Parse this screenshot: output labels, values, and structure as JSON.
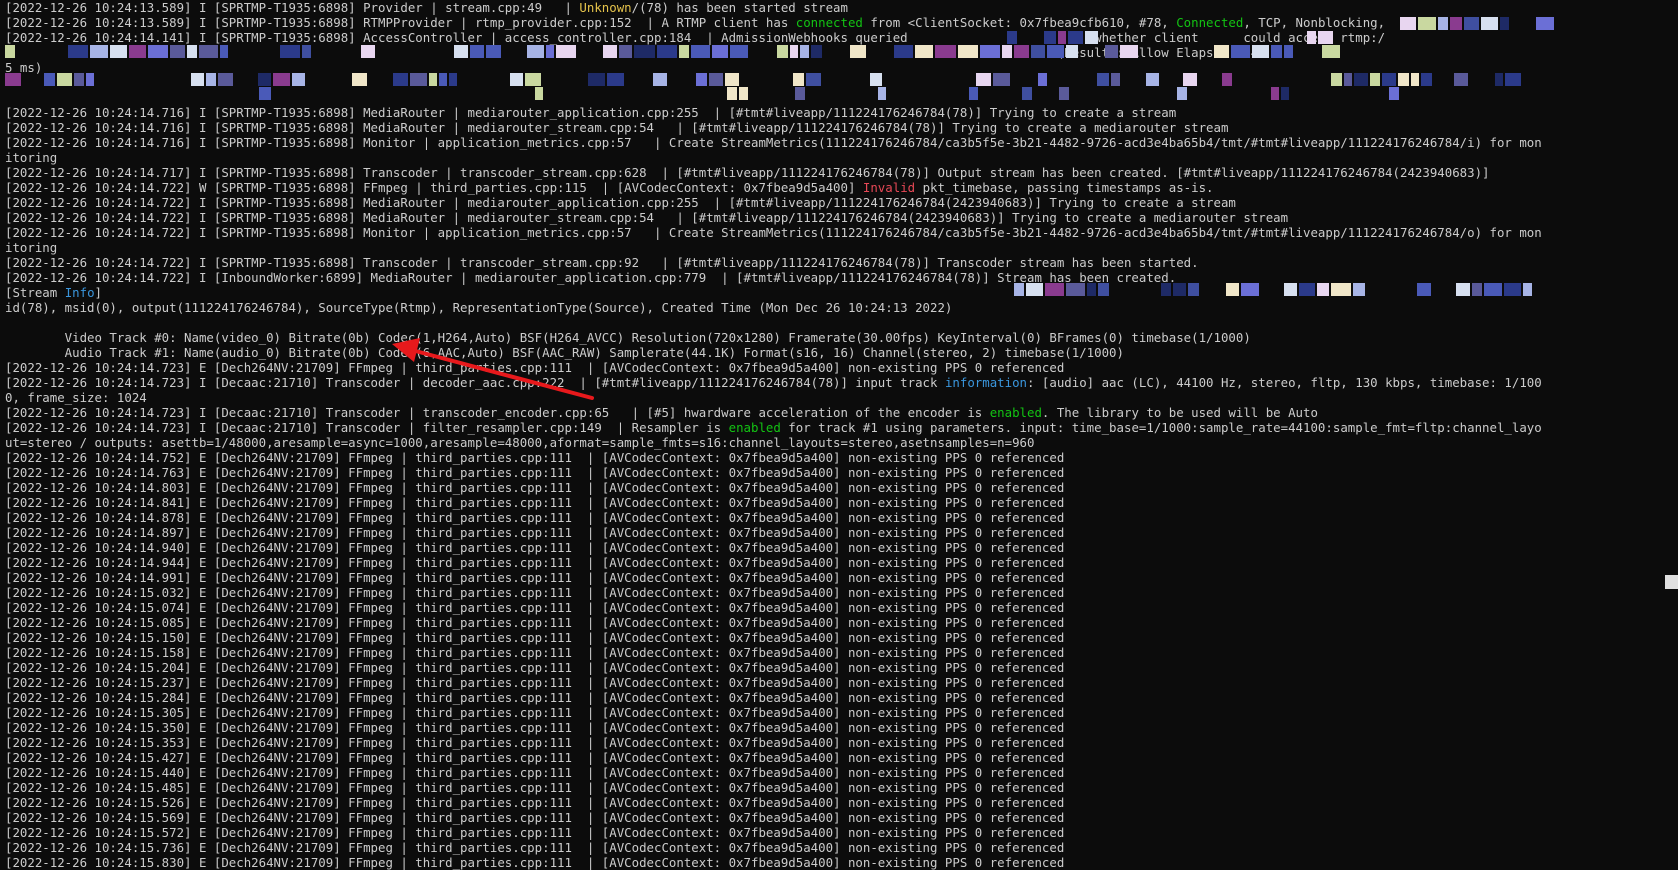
{
  "terminal": {
    "lines": [
      {
        "segments": [
          {
            "t": "[2022-12-26 10:24:13.589] I [SPRTMP-T1935:6898] Provider | stream.cpp:49   | "
          },
          {
            "t": "Unknown",
            "c": "yellow"
          },
          {
            "t": "/(78) has been started stream"
          }
        ]
      },
      {
        "segments": [
          {
            "t": "[2022-12-26 10:24:13.589] I [SPRTMP-T1935:6898] RTMPProvider | rtmp_provider.cpp:152  | A RTMP client has "
          },
          {
            "t": "connected",
            "c": "green"
          },
          {
            "t": " from <ClientSocket: 0x7fbea9cfb610, #78, "
          },
          {
            "t": "Connected",
            "c": "green"
          },
          {
            "t": ", TCP, Nonblocking,"
          }
        ]
      },
      {
        "segments": [
          {
            "t": "[2022-12-26 10:24:14.141] I [SPRTMP-T1935:6898] AccessController | access_controller.cpp:184  | AdmissionWebhooks queried"
          },
          {
            "t": "                         whether client      could access rtmp:/"
          }
        ]
      },
      {
        "segments": [
          {
            "t": "                                                                                                                                             (Result : Allow Elapsed : 4"
          }
        ]
      },
      {
        "segments": [
          {
            "t": "5 ms)"
          }
        ]
      },
      {
        "segments": [
          {
            "t": ""
          }
        ]
      },
      {
        "segments": [
          {
            "t": ""
          }
        ]
      },
      {
        "segments": [
          {
            "t": "[2022-12-26 10:24:14.716] I [SPRTMP-T1935:6898] MediaRouter | mediarouter_application.cpp:255  | [#tmt#liveapp/111224176246784(78)] Trying to create a stream"
          }
        ]
      },
      {
        "segments": [
          {
            "t": "[2022-12-26 10:24:14.716] I [SPRTMP-T1935:6898] MediaRouter | mediarouter_stream.cpp:54   | [#tmt#liveapp/111224176246784(78)] Trying to create a mediarouter stream"
          }
        ]
      },
      {
        "segments": [
          {
            "t": "[2022-12-26 10:24:14.716] I [SPRTMP-T1935:6898] Monitor | application_metrics.cpp:57   | Create StreamMetrics(111224176246784/ca3b5f5e-3b21-4482-9726-acd3e4ba65b4/tmt/#tmt#liveapp/111224176246784/i) for mon"
          }
        ]
      },
      {
        "segments": [
          {
            "t": "itoring"
          }
        ]
      },
      {
        "segments": [
          {
            "t": "[2022-12-26 10:24:14.717] I [SPRTMP-T1935:6898] Transcoder | transcoder_stream.cpp:628  | [#tmt#liveapp/111224176246784(78)] Output stream has been created. [#tmt#liveapp/111224176246784(2423940683)]"
          }
        ]
      },
      {
        "segments": [
          {
            "t": "[2022-12-26 10:24:14.722] W [SPRTMP-T1935:6898] FFmpeg | third_parties.cpp:115  | [AVCodecContext: 0x7fbea9d5a400] "
          },
          {
            "t": "Invalid",
            "c": "red"
          },
          {
            "t": " pkt_timebase, passing timestamps as-is."
          }
        ]
      },
      {
        "segments": [
          {
            "t": "[2022-12-26 10:24:14.722] I [SPRTMP-T1935:6898] MediaRouter | mediarouter_application.cpp:255  | [#tmt#liveapp/111224176246784(2423940683)] Trying to create a stream"
          }
        ]
      },
      {
        "segments": [
          {
            "t": "[2022-12-26 10:24:14.722] I [SPRTMP-T1935:6898] MediaRouter | mediarouter_stream.cpp:54   | [#tmt#liveapp/111224176246784(2423940683)] Trying to create a mediarouter stream"
          }
        ]
      },
      {
        "segments": [
          {
            "t": "[2022-12-26 10:24:14.722] I [SPRTMP-T1935:6898] Monitor | application_metrics.cpp:57   | Create StreamMetrics(111224176246784/ca3b5f5e-3b21-4482-9726-acd3e4ba65b4/tmt/#tmt#liveapp/111224176246784/o) for mon"
          }
        ]
      },
      {
        "segments": [
          {
            "t": "itoring"
          }
        ]
      },
      {
        "segments": [
          {
            "t": "[2022-12-26 10:24:14.722] I [SPRTMP-T1935:6898] Transcoder | transcoder_stream.cpp:92   | [#tmt#liveapp/111224176246784(78)] Transcoder stream has been started."
          }
        ]
      },
      {
        "segments": [
          {
            "t": "[2022-12-26 10:24:14.722] I [InboundWorker:6899] MediaRouter | mediarouter_application.cpp:779  | [#tmt#liveapp/111224176246784(78)] Stream has been created."
          }
        ]
      },
      {
        "segments": [
          {
            "t": "[Stream "
          },
          {
            "t": "Info",
            "c": "cyan"
          },
          {
            "t": "]"
          }
        ]
      },
      {
        "segments": [
          {
            "t": "id(78), msid(0), output(111224176246784), SourceType(Rtmp), RepresentationType(Source), Created Time (Mon Dec 26 10:24:13 2022)"
          }
        ]
      },
      {
        "segments": [
          {
            "t": ""
          }
        ]
      },
      {
        "segments": [
          {
            "t": "        Video Track #0: Name(video_0) Bitrate(0b) Codec(1,H264,Auto) BSF(H264_AVCC) Resolution(720x1280) Framerate(30.00fps) KeyInterval(0) BFrames(0) timebase(1/1000)"
          }
        ]
      },
      {
        "segments": [
          {
            "t": "        Audio Track #1: Name(audio_0) Bitrate(0b) Codec(6,AAC,Auto) BSF(AAC_RAW) Samplerate(44.1K) Format(s16, 16) Channel(stereo, 2) timebase(1/1000)"
          }
        ]
      },
      {
        "segments": [
          {
            "t": "[2022-12-26 10:24:14.723] E [Dech264NV:21709] FFmpeg | third_parties.cpp:111  | [AVCodecContext: 0x7fbea9d5a400] non-existing PPS 0 referenced"
          }
        ]
      },
      {
        "segments": [
          {
            "t": "[2022-12-26 10:24:14.723] I [Decaac:21710] Transcoder | decoder_aac.cpp:222  | [#tmt#liveapp/111224176246784(78)] input track "
          },
          {
            "t": "information",
            "c": "cyan"
          },
          {
            "t": ": [audio] aac (LC), 44100 Hz, stereo, fltp, 130 kbps, timebase: 1/100"
          }
        ]
      },
      {
        "segments": [
          {
            "t": "0, frame_size: 1024"
          }
        ]
      },
      {
        "segments": [
          {
            "t": "[2022-12-26 10:24:14.723] I [Decaac:21710] Transcoder | transcoder_encoder.cpp:65   | [#5] hwardware acceleration of the encoder is "
          },
          {
            "t": "enabled",
            "c": "green"
          },
          {
            "t": ". The library to be used will be Auto"
          }
        ]
      },
      {
        "segments": [
          {
            "t": "[2022-12-26 10:24:14.723] I [Decaac:21710] Transcoder | filter_resampler.cpp:149  | Resampler is "
          },
          {
            "t": "enabled",
            "c": "green"
          },
          {
            "t": " for track #1 using parameters. input: time_base=1/1000:sample_rate=44100:sample_fmt=fltp:channel_layo"
          }
        ]
      },
      {
        "segments": [
          {
            "t": "ut=stereo / outputs: asettb=1/48000,aresample=async=1000,aresample=48000,aformat=sample_fmts=s16:channel_layouts=stereo,asetnsamples=n=960"
          }
        ]
      },
      {
        "segments": [
          {
            "t": "[2022-12-26 10:24:14.752] E [Dech264NV:21709] FFmpeg | third_parties.cpp:111  | [AVCodecContext: 0x7fbea9d5a400] non-existing PPS 0 referenced"
          }
        ]
      },
      {
        "segments": [
          {
            "t": "[2022-12-26 10:24:14.763] E [Dech264NV:21709] FFmpeg | third_parties.cpp:111  | [AVCodecContext: 0x7fbea9d5a400] non-existing PPS 0 referenced"
          }
        ]
      },
      {
        "segments": [
          {
            "t": "[2022-12-26 10:24:14.803] E [Dech264NV:21709] FFmpeg | third_parties.cpp:111  | [AVCodecContext: 0x7fbea9d5a400] non-existing PPS 0 referenced"
          }
        ]
      },
      {
        "segments": [
          {
            "t": "[2022-12-26 10:24:14.841] E [Dech264NV:21709] FFmpeg | third_parties.cpp:111  | [AVCodecContext: 0x7fbea9d5a400] non-existing PPS 0 referenced"
          }
        ]
      },
      {
        "segments": [
          {
            "t": "[2022-12-26 10:24:14.878] E [Dech264NV:21709] FFmpeg | third_parties.cpp:111  | [AVCodecContext: 0x7fbea9d5a400] non-existing PPS 0 referenced"
          }
        ]
      },
      {
        "segments": [
          {
            "t": "[2022-12-26 10:24:14.897] E [Dech264NV:21709] FFmpeg | third_parties.cpp:111  | [AVCodecContext: 0x7fbea9d5a400] non-existing PPS 0 referenced"
          }
        ]
      },
      {
        "segments": [
          {
            "t": "[2022-12-26 10:24:14.940] E [Dech264NV:21709] FFmpeg | third_parties.cpp:111  | [AVCodecContext: 0x7fbea9d5a400] non-existing PPS 0 referenced"
          }
        ]
      },
      {
        "segments": [
          {
            "t": "[2022-12-26 10:24:14.944] E [Dech264NV:21709] FFmpeg | third_parties.cpp:111  | [AVCodecContext: 0x7fbea9d5a400] non-existing PPS 0 referenced"
          }
        ]
      },
      {
        "segments": [
          {
            "t": "[2022-12-26 10:24:14.991] E [Dech264NV:21709] FFmpeg | third_parties.cpp:111  | [AVCodecContext: 0x7fbea9d5a400] non-existing PPS 0 referenced"
          }
        ]
      },
      {
        "segments": [
          {
            "t": "[2022-12-26 10:24:15.032] E [Dech264NV:21709] FFmpeg | third_parties.cpp:111  | [AVCodecContext: 0x7fbea9d5a400] non-existing PPS 0 referenced"
          }
        ]
      },
      {
        "segments": [
          {
            "t": "[2022-12-26 10:24:15.074] E [Dech264NV:21709] FFmpeg | third_parties.cpp:111  | [AVCodecContext: 0x7fbea9d5a400] non-existing PPS 0 referenced"
          }
        ]
      },
      {
        "segments": [
          {
            "t": "[2022-12-26 10:24:15.085] E [Dech264NV:21709] FFmpeg | third_parties.cpp:111  | [AVCodecContext: 0x7fbea9d5a400] non-existing PPS 0 referenced"
          }
        ]
      },
      {
        "segments": [
          {
            "t": "[2022-12-26 10:24:15.150] E [Dech264NV:21709] FFmpeg | third_parties.cpp:111  | [AVCodecContext: 0x7fbea9d5a400] non-existing PPS 0 referenced"
          }
        ]
      },
      {
        "segments": [
          {
            "t": "[2022-12-26 10:24:15.158] E [Dech264NV:21709] FFmpeg | third_parties.cpp:111  | [AVCodecContext: 0x7fbea9d5a400] non-existing PPS 0 referenced"
          }
        ]
      },
      {
        "segments": [
          {
            "t": "[2022-12-26 10:24:15.204] E [Dech264NV:21709] FFmpeg | third_parties.cpp:111  | [AVCodecContext: 0x7fbea9d5a400] non-existing PPS 0 referenced"
          }
        ]
      },
      {
        "segments": [
          {
            "t": "[2022-12-26 10:24:15.237] E [Dech264NV:21709] FFmpeg | third_parties.cpp:111  | [AVCodecContext: 0x7fbea9d5a400] non-existing PPS 0 referenced"
          }
        ]
      },
      {
        "segments": [
          {
            "t": "[2022-12-26 10:24:15.284] E [Dech264NV:21709] FFmpeg | third_parties.cpp:111  | [AVCodecContext: 0x7fbea9d5a400] non-existing PPS 0 referenced"
          }
        ]
      },
      {
        "segments": [
          {
            "t": "[2022-12-26 10:24:15.305] E [Dech264NV:21709] FFmpeg | third_parties.cpp:111  | [AVCodecContext: 0x7fbea9d5a400] non-existing PPS 0 referenced"
          }
        ]
      },
      {
        "segments": [
          {
            "t": "[2022-12-26 10:24:15.350] E [Dech264NV:21709] FFmpeg | third_parties.cpp:111  | [AVCodecContext: 0x7fbea9d5a400] non-existing PPS 0 referenced"
          }
        ]
      },
      {
        "segments": [
          {
            "t": "[2022-12-26 10:24:15.353] E [Dech264NV:21709] FFmpeg | third_parties.cpp:111  | [AVCodecContext: 0x7fbea9d5a400] non-existing PPS 0 referenced"
          }
        ]
      },
      {
        "segments": [
          {
            "t": "[2022-12-26 10:24:15.427] E [Dech264NV:21709] FFmpeg | third_parties.cpp:111  | [AVCodecContext: 0x7fbea9d5a400] non-existing PPS 0 referenced"
          }
        ]
      },
      {
        "segments": [
          {
            "t": "[2022-12-26 10:24:15.440] E [Dech264NV:21709] FFmpeg | third_parties.cpp:111  | [AVCodecContext: 0x7fbea9d5a400] non-existing PPS 0 referenced"
          }
        ]
      },
      {
        "segments": [
          {
            "t": "[2022-12-26 10:24:15.485] E [Dech264NV:21709] FFmpeg | third_parties.cpp:111  | [AVCodecContext: 0x7fbea9d5a400] non-existing PPS 0 referenced"
          }
        ]
      },
      {
        "segments": [
          {
            "t": "[2022-12-26 10:24:15.526] E [Dech264NV:21709] FFmpeg | third_parties.cpp:111  | [AVCodecContext: 0x7fbea9d5a400] non-existing PPS 0 referenced"
          }
        ]
      },
      {
        "segments": [
          {
            "t": "[2022-12-26 10:24:15.569] E [Dech264NV:21709] FFmpeg | third_parties.cpp:111  | [AVCodecContext: 0x7fbea9d5a400] non-existing PPS 0 referenced"
          }
        ]
      },
      {
        "segments": [
          {
            "t": "[2022-12-26 10:24:15.572] E [Dech264NV:21709] FFmpeg | third_parties.cpp:111  | [AVCodecContext: 0x7fbea9d5a400] non-existing PPS 0 referenced"
          }
        ]
      },
      {
        "segments": [
          {
            "t": "[2022-12-26 10:24:15.736] E [Dech264NV:21709] FFmpeg | third_parties.cpp:111  | [AVCodecContext: 0x7fbea9d5a400] non-existing PPS 0 referenced"
          }
        ]
      },
      {
        "segments": [
          {
            "t": "[2022-12-26 10:24:15.830] E [Dech264NV:21709] FFmpeg | third_parties.cpp:111  | [AVCodecContext: 0x7fbea9d5a400] non-existing PPS 0 referenced"
          }
        ]
      }
    ]
  },
  "colors": {
    "background": "#0c0c0c",
    "foreground": "#cccccc",
    "yellow": "#e5c34b",
    "green": "#13c313",
    "red": "#e74856",
    "cyan": "#3a96dd",
    "annotation_arrow": "#e8191c"
  },
  "annotation": {
    "type": "arrow",
    "points_to": "Bitrate(0b)"
  }
}
